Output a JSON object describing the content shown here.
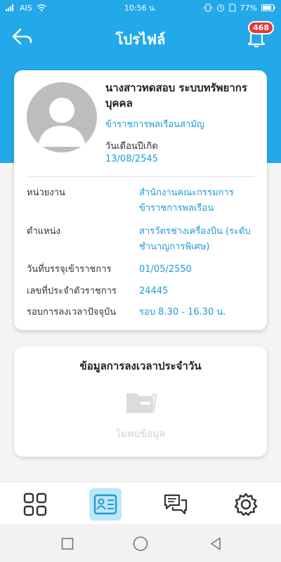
{
  "status_bar": {
    "carrier": "AIS",
    "time": "10:56 น.",
    "battery": "77%"
  },
  "header": {
    "title": "โปรไฟล์",
    "notification_count": "468"
  },
  "profile": {
    "name": "นางสาวทดสอบ ระบบทรัพยากรบุคคล",
    "rank": "ข้าราชการพลเรือนสามัญ",
    "dob_label": "วันเดือนปีเกิด",
    "dob_value": "13/08/2545",
    "rows": [
      {
        "label": "หน่วยงาน",
        "value": "สำนักงานคณะกรรมการข้าราชการพลเรือน"
      },
      {
        "label": "ตำแหน่ง",
        "value": "สารวัตรช่างเครื่องบิน (ระดับชำนาญการพิเศษ)"
      },
      {
        "label": "วันที่บรรจุเข้าราชการ",
        "value": "01/05/2550"
      },
      {
        "label": "เลขที่ประจำตัวราชการ",
        "value": "24445"
      },
      {
        "label": "รอบการลงเวลาปัจจุบัน",
        "value": "รอบ 8.30 - 16.30 น."
      }
    ]
  },
  "daily": {
    "title": "ข้อมูลการลงเวลาประจำวัน",
    "empty_text": "ไม่พบข้อมูล"
  },
  "icons": {
    "back": "back-arrow-icon",
    "bell": "bell-icon",
    "nav": [
      "grid-icon",
      "id-card-icon",
      "chat-icon",
      "gear-icon"
    ]
  },
  "colors": {
    "primary": "#23a8ea",
    "accent_text": "#1e9bd7",
    "badge": "#e53935",
    "nav_active_bg": "#bfe6f6"
  }
}
